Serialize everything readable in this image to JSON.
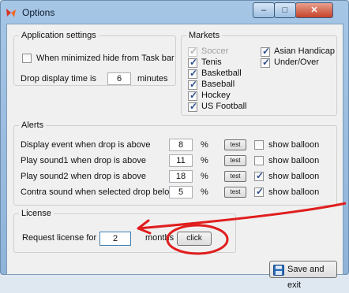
{
  "window": {
    "title": "Options",
    "caption": {
      "minimize": "–",
      "maximize": "□",
      "close": "✕"
    }
  },
  "app_settings": {
    "title": "Application settings",
    "hide_taskbar": {
      "label": "When minimized hide from Task bar",
      "checked": false
    },
    "drop_display": {
      "prefix": "Drop display time is",
      "value": "6",
      "suffix": "minutes"
    }
  },
  "markets": {
    "title": "Markets",
    "items": [
      {
        "label": "Soccer",
        "checked": true,
        "disabled": true
      },
      {
        "label": "Tenis",
        "checked": true,
        "disabled": false
      },
      {
        "label": "Basketball",
        "checked": true,
        "disabled": false
      },
      {
        "label": "Baseball",
        "checked": true,
        "disabled": false
      },
      {
        "label": "Hockey",
        "checked": true,
        "disabled": false
      },
      {
        "label": "US Football",
        "checked": true,
        "disabled": false
      },
      {
        "label": "Asian Handicap",
        "checked": true,
        "disabled": false
      },
      {
        "label": "Under/Over",
        "checked": true,
        "disabled": false
      }
    ]
  },
  "alerts": {
    "title": "Alerts",
    "test_label": "test",
    "balloon_label": "show balloon",
    "rows": [
      {
        "label": "Display event when drop is above",
        "value": "8",
        "unit": "%",
        "balloon": false
      },
      {
        "label": "Play sound1 when drop is above",
        "value": "11",
        "unit": "%",
        "balloon": false
      },
      {
        "label": "Play sound2 when drop is above",
        "value": "18",
        "unit": "%",
        "balloon": true
      },
      {
        "label": "Contra sound when selected drop below",
        "value": "5",
        "unit": "%",
        "balloon": true
      }
    ]
  },
  "license": {
    "title": "License",
    "request_label": "Request license for",
    "months_value": "2",
    "months_label": "months",
    "click_label": "click"
  },
  "footer": {
    "save_label": "Save and exit"
  },
  "colors": {
    "annotation": "#e01e1e",
    "checkmark": "#2a4e8f",
    "save_icon": "#2b6cb8"
  }
}
